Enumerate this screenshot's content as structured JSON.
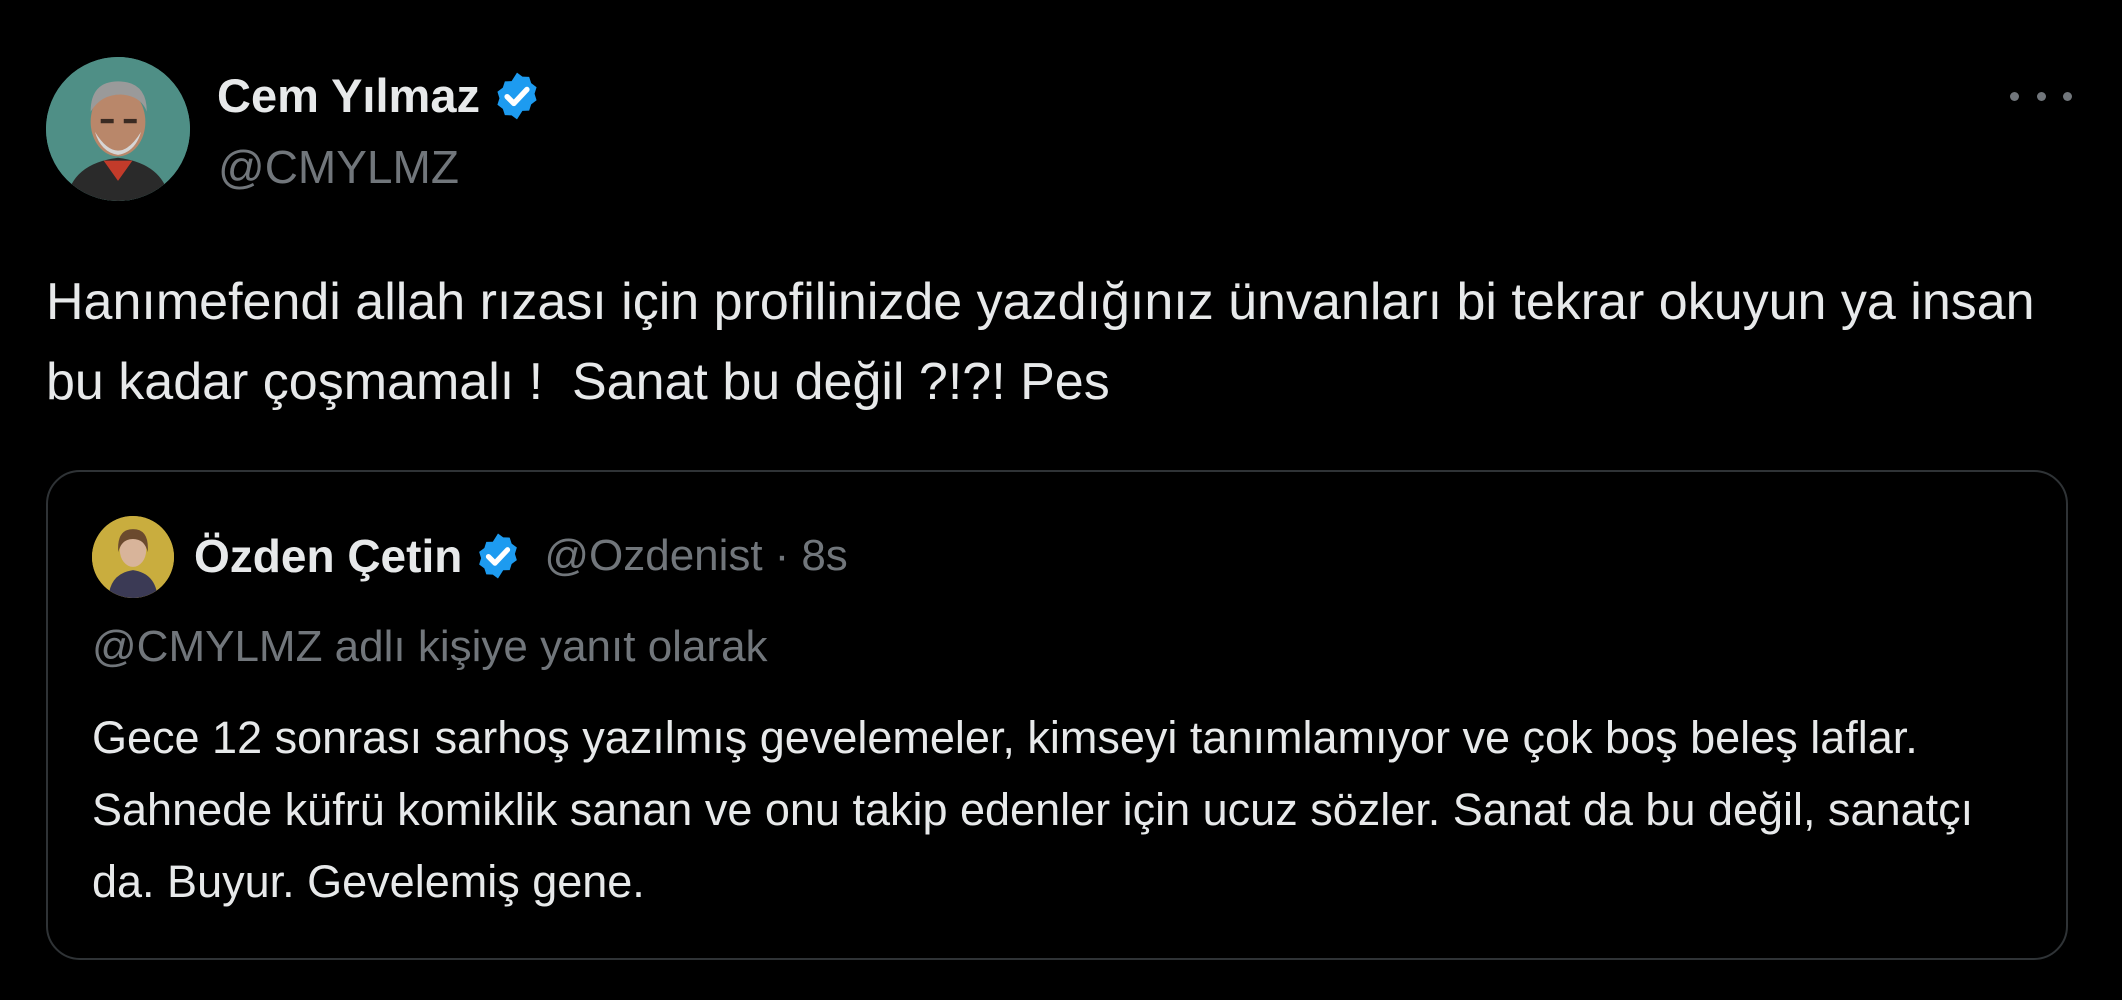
{
  "tweet": {
    "author": {
      "name": "Cem Yılmaz",
      "handle": "@CMYLMZ"
    },
    "text": "Hanımefendi allah rızası için profilinizde yazdığınız ünvanları bi tekrar okuyun ya insan bu kadar çoşmamalı !  Sanat bu değil ?!?! Pes",
    "more_icon": "ellipsis-icon"
  },
  "quote": {
    "author": {
      "name": "Özden Çetin",
      "handle": "@Ozdenist",
      "separator": "·",
      "time": "8s"
    },
    "reply_context": "@CMYLMZ adlı kişiye yanıt olarak",
    "text": "Gece 12 sonrası sarhoş yazılmış gevelemeler, kimseyi tanımlamıyor ve çok boş beleş laflar. Sahnede küfrü komiklik sanan ve onu takip edenler için ucuz sözler. Sanat da bu değil, sanatçı da. Buyur. Gevelemiş gene."
  },
  "colors": {
    "background": "#000000",
    "text_primary": "#e7e9ea",
    "text_secondary": "#71767b",
    "border": "#2f3336",
    "verified_badge": "#1d9bf0"
  }
}
